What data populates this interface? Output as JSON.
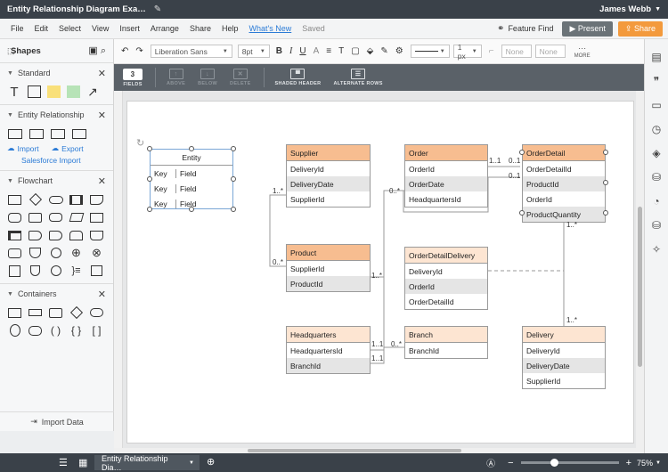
{
  "titlebar": {
    "title": "Entity Relationship Diagram Exa…",
    "user": "James Webb"
  },
  "menu": {
    "items": [
      "File",
      "Edit",
      "Select",
      "View",
      "Insert",
      "Arrange",
      "Share",
      "Help"
    ],
    "whats_new": "What's New",
    "saved": "Saved",
    "feature_find": "Feature Find",
    "present": "Present",
    "share": "Share"
  },
  "toolbar": {
    "font": "Liberation Sans",
    "font_size": "8pt",
    "line_width": "1 px",
    "fill_none": "None",
    "fill_none2": "None",
    "more": "MORE"
  },
  "table_toolbar": {
    "fields_value": "3",
    "fields_label": "FIELDS",
    "above_label": "ABOVE",
    "below_label": "BELOW",
    "delete_label": "DELETE",
    "shaded_header_label": "SHADED HEADER",
    "alternate_rows_label": "ALTERNATE ROWS"
  },
  "left_panel": {
    "shapes_label": "Shapes",
    "libraries": [
      {
        "name": "Standard"
      },
      {
        "name": "Entity Relationship",
        "import": "Import",
        "export": "Export",
        "salesforce": "Salesforce Import"
      },
      {
        "name": "Flowchart"
      },
      {
        "name": "Containers"
      }
    ],
    "import_data": "Import Data"
  },
  "diagram": {
    "entity_shape": {
      "title": "Entity",
      "rows": [
        [
          "Key",
          "Field"
        ],
        [
          "Key",
          "Field"
        ],
        [
          "Key",
          "Field"
        ]
      ]
    },
    "entities": [
      {
        "id": "supplier",
        "title": "Supplier",
        "fields": [
          "DeliveryId",
          "DeliveryDate",
          "SupplierId"
        ]
      },
      {
        "id": "order",
        "title": "Order",
        "fields": [
          "OrderId",
          "OrderDate",
          "HeadquartersId"
        ]
      },
      {
        "id": "orderdetail",
        "title": "OrderDetail",
        "fields": [
          "OrderDetailId",
          "ProductId",
          "OrderId",
          "ProductQuantity"
        ]
      },
      {
        "id": "product",
        "title": "Product",
        "fields": [
          "SupplierId",
          "ProductId"
        ]
      },
      {
        "id": "odd",
        "title": "OrderDetailDelivery",
        "fields": [
          "DeliveryId",
          "OrderId",
          "OrderDetailId"
        ]
      },
      {
        "id": "headquarters",
        "title": "Headquarters",
        "fields": [
          "HeadquartersId",
          "BranchId"
        ]
      },
      {
        "id": "branch",
        "title": "Branch",
        "fields": [
          "BranchId"
        ]
      },
      {
        "id": "delivery",
        "title": "Delivery",
        "fields": [
          "DeliveryId",
          "DeliveryDate",
          "SupplierId"
        ]
      }
    ],
    "cardinalities": [
      "1..*",
      "0..*",
      "1..1",
      "0..1",
      "0..1",
      "0..*",
      "1..*",
      "1..*",
      "1..*",
      "1..1",
      "1..1",
      "0..*"
    ]
  },
  "bottom": {
    "page_tab": "Entity Relationship Dia…",
    "zoom": "75%"
  },
  "colors": {
    "header_dark": "#f7bd90",
    "header_light": "#fde5d2",
    "row_shade": "#e5e5e5",
    "accent": "#f39a3d",
    "chrome": "#3a4149"
  }
}
